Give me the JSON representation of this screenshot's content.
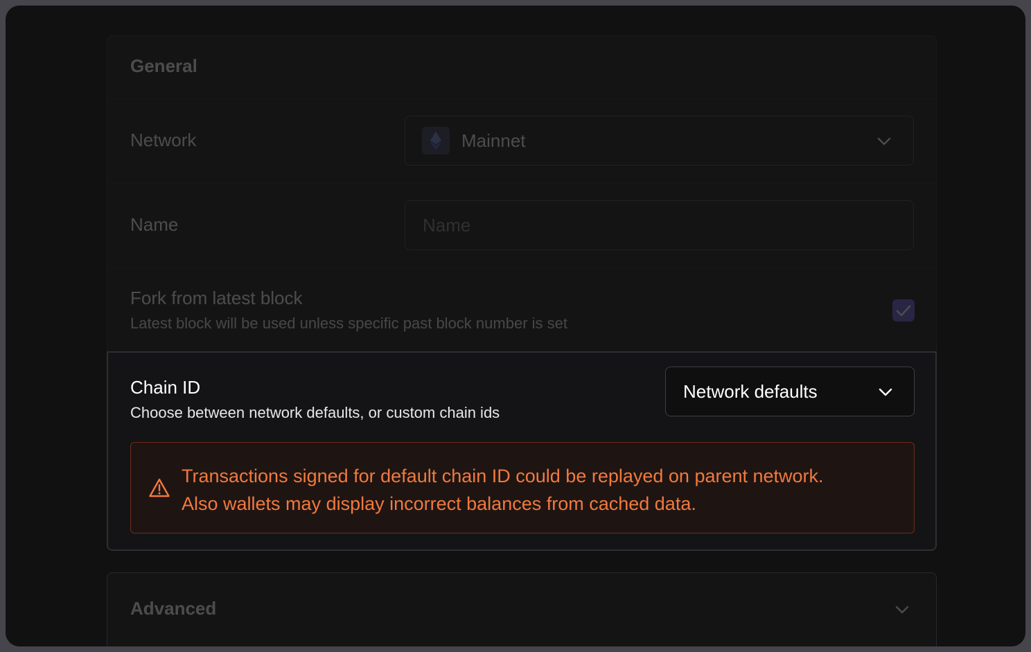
{
  "general": {
    "title": "General",
    "network": {
      "label": "Network",
      "value": "Mainnet",
      "icon": "ethereum-icon"
    },
    "name": {
      "label": "Name",
      "placeholder": "Name"
    },
    "fork": {
      "label": "Fork from latest block",
      "description": "Latest block will be used unless specific past block number is set",
      "checked": true
    },
    "chain_id": {
      "label": "Chain ID",
      "description": "Choose between network defaults, or custom chain ids",
      "value": "Network defaults"
    },
    "warning": {
      "line1": "Transactions signed for default chain ID could be replayed on parent network.",
      "line2": "Also wallets may display incorrect balances from cached data.",
      "color": "#f2793d"
    }
  },
  "advanced": {
    "title": "Advanced"
  }
}
